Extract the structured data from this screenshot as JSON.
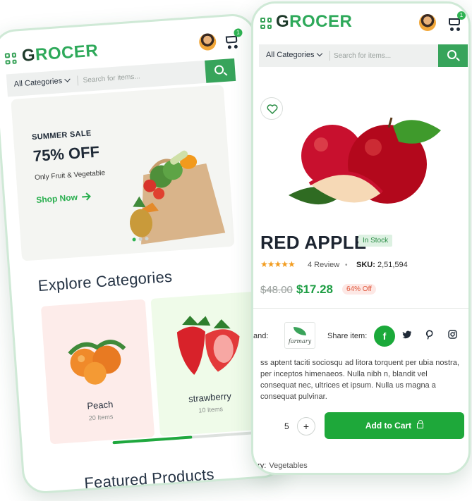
{
  "brand": {
    "logo_first": "G",
    "logo_rest": "ROCER",
    "cart_count": "1"
  },
  "search": {
    "category": "All Categories",
    "placeholder": "Search for items..."
  },
  "home": {
    "hero": {
      "tag": "SUMMER SALE",
      "title": "75% OFF",
      "subtitle": "Only Fruit & Vegetable",
      "cta": "Shop Now"
    },
    "explore_title": "Explore Categories",
    "categories": [
      {
        "name": "Peach",
        "count": "20 Items"
      },
      {
        "name": "strawberry",
        "count": "10 Items"
      }
    ],
    "scroll_progress": 0.5,
    "featured_title": "Featured Products"
  },
  "product": {
    "title": "RED APPLE",
    "stock": "In Stock",
    "stars": "★★★★★",
    "review": "4 Review",
    "sku_label": "SKU:",
    "sku_value": "2,51,594",
    "old_price": "$48.00",
    "new_price": "$17.28",
    "discount": "64% Off",
    "brand_label": "and:",
    "brand_name": "farmary",
    "share_label": "Share item:",
    "share_facebook": "f",
    "description": "ss aptent taciti sociosqu ad litora torquent per ubia nostra, per inceptos himenaeos. Nulla nibh n, blandit vel consequat nec, ultrices et ipsum. Nulla us magna a consequat pulvinar.",
    "quantity": "5",
    "plus": "+",
    "add_to_cart": "Add to Cart",
    "category_label": "ory:",
    "category_value": "Vegetables"
  },
  "colors": {
    "accent": "#37a45b",
    "cta": "#1ea83a",
    "price": "#1d9d43",
    "stars": "#f29c1f"
  }
}
